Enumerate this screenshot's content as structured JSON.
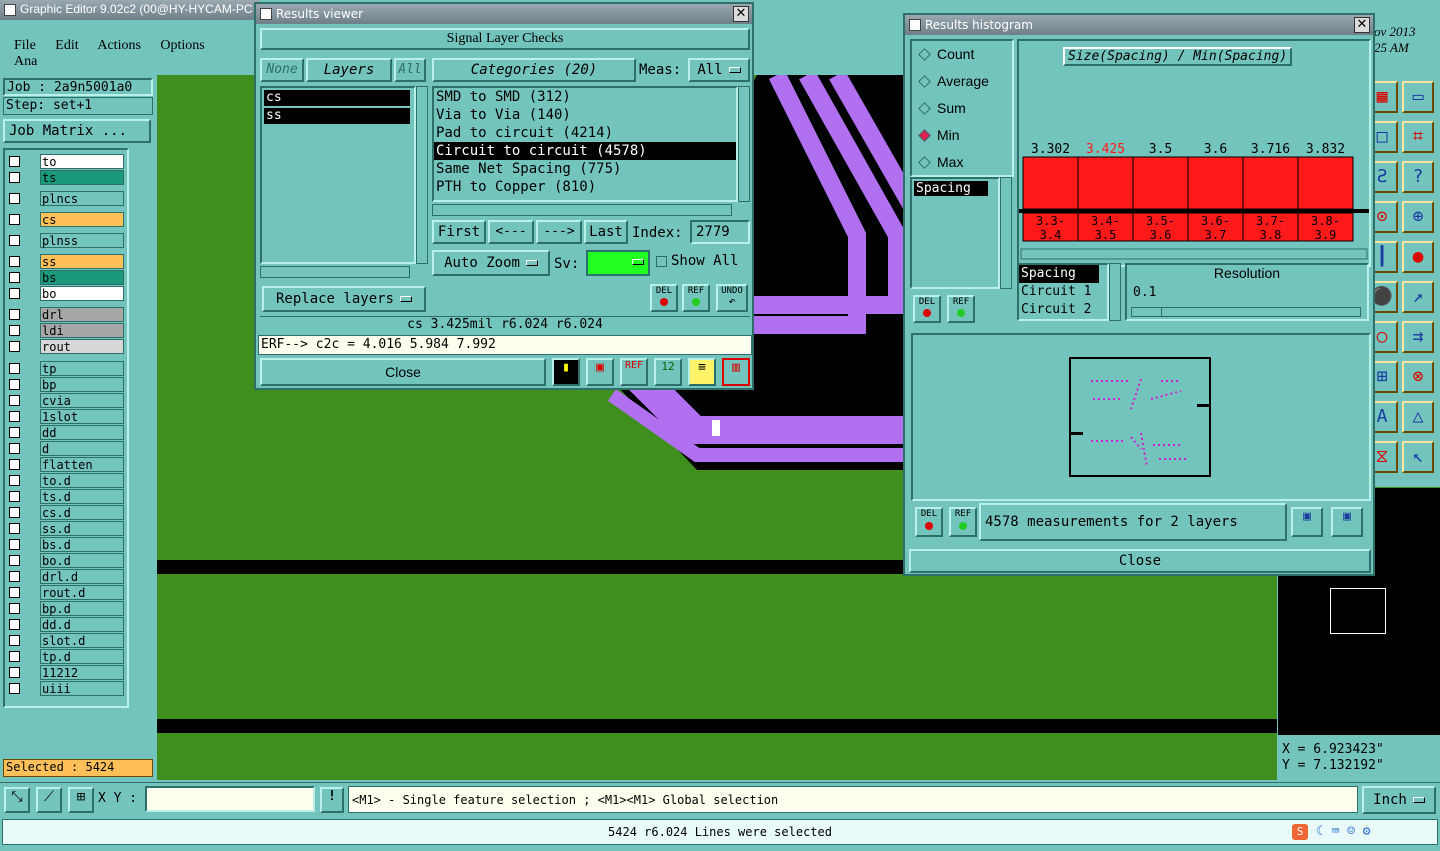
{
  "app": {
    "title": "Graphic Editor 9.02c2 (00@HY-HYCAM-PC",
    "menu": [
      "File",
      "Edit",
      "Actions",
      "Options",
      "Ana"
    ],
    "clock": [
      "ov 2013",
      "25 AM"
    ]
  },
  "job": {
    "job": "Job : 2a9n5001a0",
    "step": "Step: set+1",
    "matrix_label": "Job Matrix ..."
  },
  "layers": [
    {
      "name": "to",
      "color": "#ffffff"
    },
    {
      "name": "ts",
      "color": "#1a9a7a"
    },
    {
      "name": "plncs",
      "color": "#74c4be"
    },
    {
      "name": "cs",
      "color": "#ffc05a"
    },
    {
      "name": "plnss",
      "color": "#74c4be"
    },
    {
      "name": "ss",
      "color": "#ffc05a"
    },
    {
      "name": "bs",
      "color": "#1a9a7a"
    },
    {
      "name": "bo",
      "color": "#ffffff"
    },
    {
      "name": "drl",
      "color": "#a7a7a7"
    },
    {
      "name": "ldi",
      "color": "#a7a7a7"
    },
    {
      "name": "rout",
      "color": "#d8d8d8"
    },
    {
      "name": "tp",
      "color": "#74c4be"
    },
    {
      "name": "bp",
      "color": "#74c4be"
    },
    {
      "name": "cvia",
      "color": "#74c4be"
    },
    {
      "name": "1slot",
      "color": "#74c4be"
    },
    {
      "name": "dd",
      "color": "#74c4be"
    },
    {
      "name": "d",
      "color": "#74c4be"
    },
    {
      "name": "flatten",
      "color": "#74c4be"
    },
    {
      "name": "to.d",
      "color": "#74c4be"
    },
    {
      "name": "ts.d",
      "color": "#74c4be"
    },
    {
      "name": "cs.d",
      "color": "#74c4be"
    },
    {
      "name": "ss.d",
      "color": "#74c4be"
    },
    {
      "name": "bs.d",
      "color": "#74c4be"
    },
    {
      "name": "bo.d",
      "color": "#74c4be"
    },
    {
      "name": "drl.d",
      "color": "#74c4be"
    },
    {
      "name": "rout.d",
      "color": "#74c4be"
    },
    {
      "name": "bp.d",
      "color": "#74c4be"
    },
    {
      "name": "dd.d",
      "color": "#74c4be"
    },
    {
      "name": "slot.d",
      "color": "#74c4be"
    },
    {
      "name": "tp.d",
      "color": "#74c4be"
    },
    {
      "name": "11212",
      "color": "#74c4be"
    },
    {
      "name": "uiii",
      "color": "#74c4be"
    }
  ],
  "selected_label": "Selected : 5424",
  "results_viewer": {
    "title": "Results viewer",
    "header": "Signal Layer Checks",
    "none": "None",
    "layers": "Layers",
    "all": "All",
    "categories": "Categories (20)",
    "meas_label": "Meas:",
    "meas_value": "All",
    "layer_items": [
      "cs",
      "ss"
    ],
    "category_items": [
      "SMD to SMD (312)",
      "Via to Via (140)",
      "Pad to circuit (4214)",
      "Circuit to circuit (4578)",
      "Same Net Spacing (775)",
      "PTH to Copper (810)"
    ],
    "selected_category": 3,
    "nav": [
      "First",
      "<---",
      "--->",
      "Last"
    ],
    "index_label": "Index:",
    "index_value": "2779",
    "auto_zoom": "Auto Zoom",
    "sv_label": "Sv:",
    "show_all": "Show All",
    "replace_layers": "Replace layers",
    "del": "DEL",
    "ref": "REF",
    "undo": "UNDO",
    "info": "cs 3.425mil   r6.024   r6.024",
    "erf": "ERF--> c2c = 4.016 5.984 7.992",
    "close": "Close"
  },
  "histogram": {
    "title": "Results histogram",
    "modes": [
      "Count",
      "Average",
      "Sum",
      "Min",
      "Max"
    ],
    "selected_mode": 3,
    "metric": "Spacing",
    "chart_title": "Size(Spacing) / Min(Spacing)",
    "axis_list": [
      "Spacing",
      "Circuit 1",
      "Circuit 2"
    ],
    "resolution_label": "Resolution",
    "resolution_value": "0.1",
    "summary": "4578 measurements for 2 layers",
    "close": "Close"
  },
  "chart_data": {
    "type": "bar",
    "title": "Size(Spacing) / Min(Spacing)",
    "categories": [
      "3.3-3.4",
      "3.4-3.5",
      "3.5-3.6",
      "3.6-3.7",
      "3.7-3.8",
      "3.8-3.9"
    ],
    "values": [
      3.302,
      3.425,
      3.5,
      3.6,
      3.716,
      3.832
    ],
    "value_labels": [
      "3.302",
      "3.425",
      "3.5",
      "3.6",
      "3.716",
      "3.832"
    ],
    "highlight_index": 1,
    "colors": {
      "bar": "#ff1a1a",
      "highlight_label": "#ff1a1a"
    }
  },
  "coords": {
    "x": "X = 6.923423\"",
    "y": "Y = 7.132192\""
  },
  "bottom": {
    "xy_label": "X Y :",
    "xy_value": "",
    "hint": "<M1> - Single feature selection ; <M1><M1> Global selection",
    "units": "Inch",
    "status": "5424 r6.024 Lines were selected"
  },
  "colors": {
    "board": "#3f8f1e",
    "trace": "#b070f0",
    "black": "#000000",
    "panel": "#74c4be"
  }
}
